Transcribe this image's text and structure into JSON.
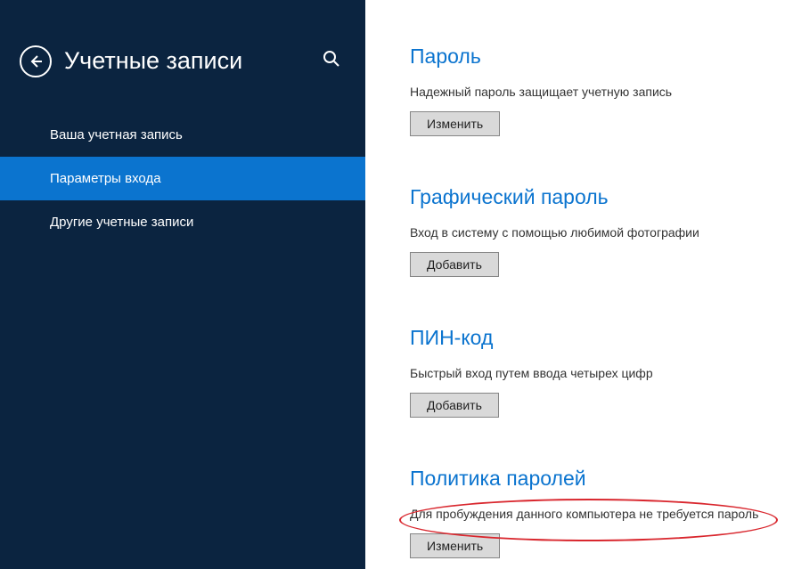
{
  "sidebar": {
    "title": "Учетные записи",
    "items": [
      {
        "label": "Ваша учетная запись",
        "active": false
      },
      {
        "label": "Параметры входа",
        "active": true
      },
      {
        "label": "Другие учетные записи",
        "active": false
      }
    ]
  },
  "content": {
    "sections": [
      {
        "title": "Пароль",
        "desc": "Надежный пароль защищает учетную запись",
        "button": "Изменить"
      },
      {
        "title": "Графический пароль",
        "desc": "Вход в систему с помощью любимой фотографии",
        "button": "Добавить"
      },
      {
        "title": "ПИН-код",
        "desc": "Быстрый вход путем ввода четырех цифр",
        "button": "Добавить"
      },
      {
        "title": "Политика паролей",
        "desc": "Для пробуждения данного компьютера не требуется пароль",
        "button": "Изменить",
        "highlighted": true
      }
    ]
  }
}
